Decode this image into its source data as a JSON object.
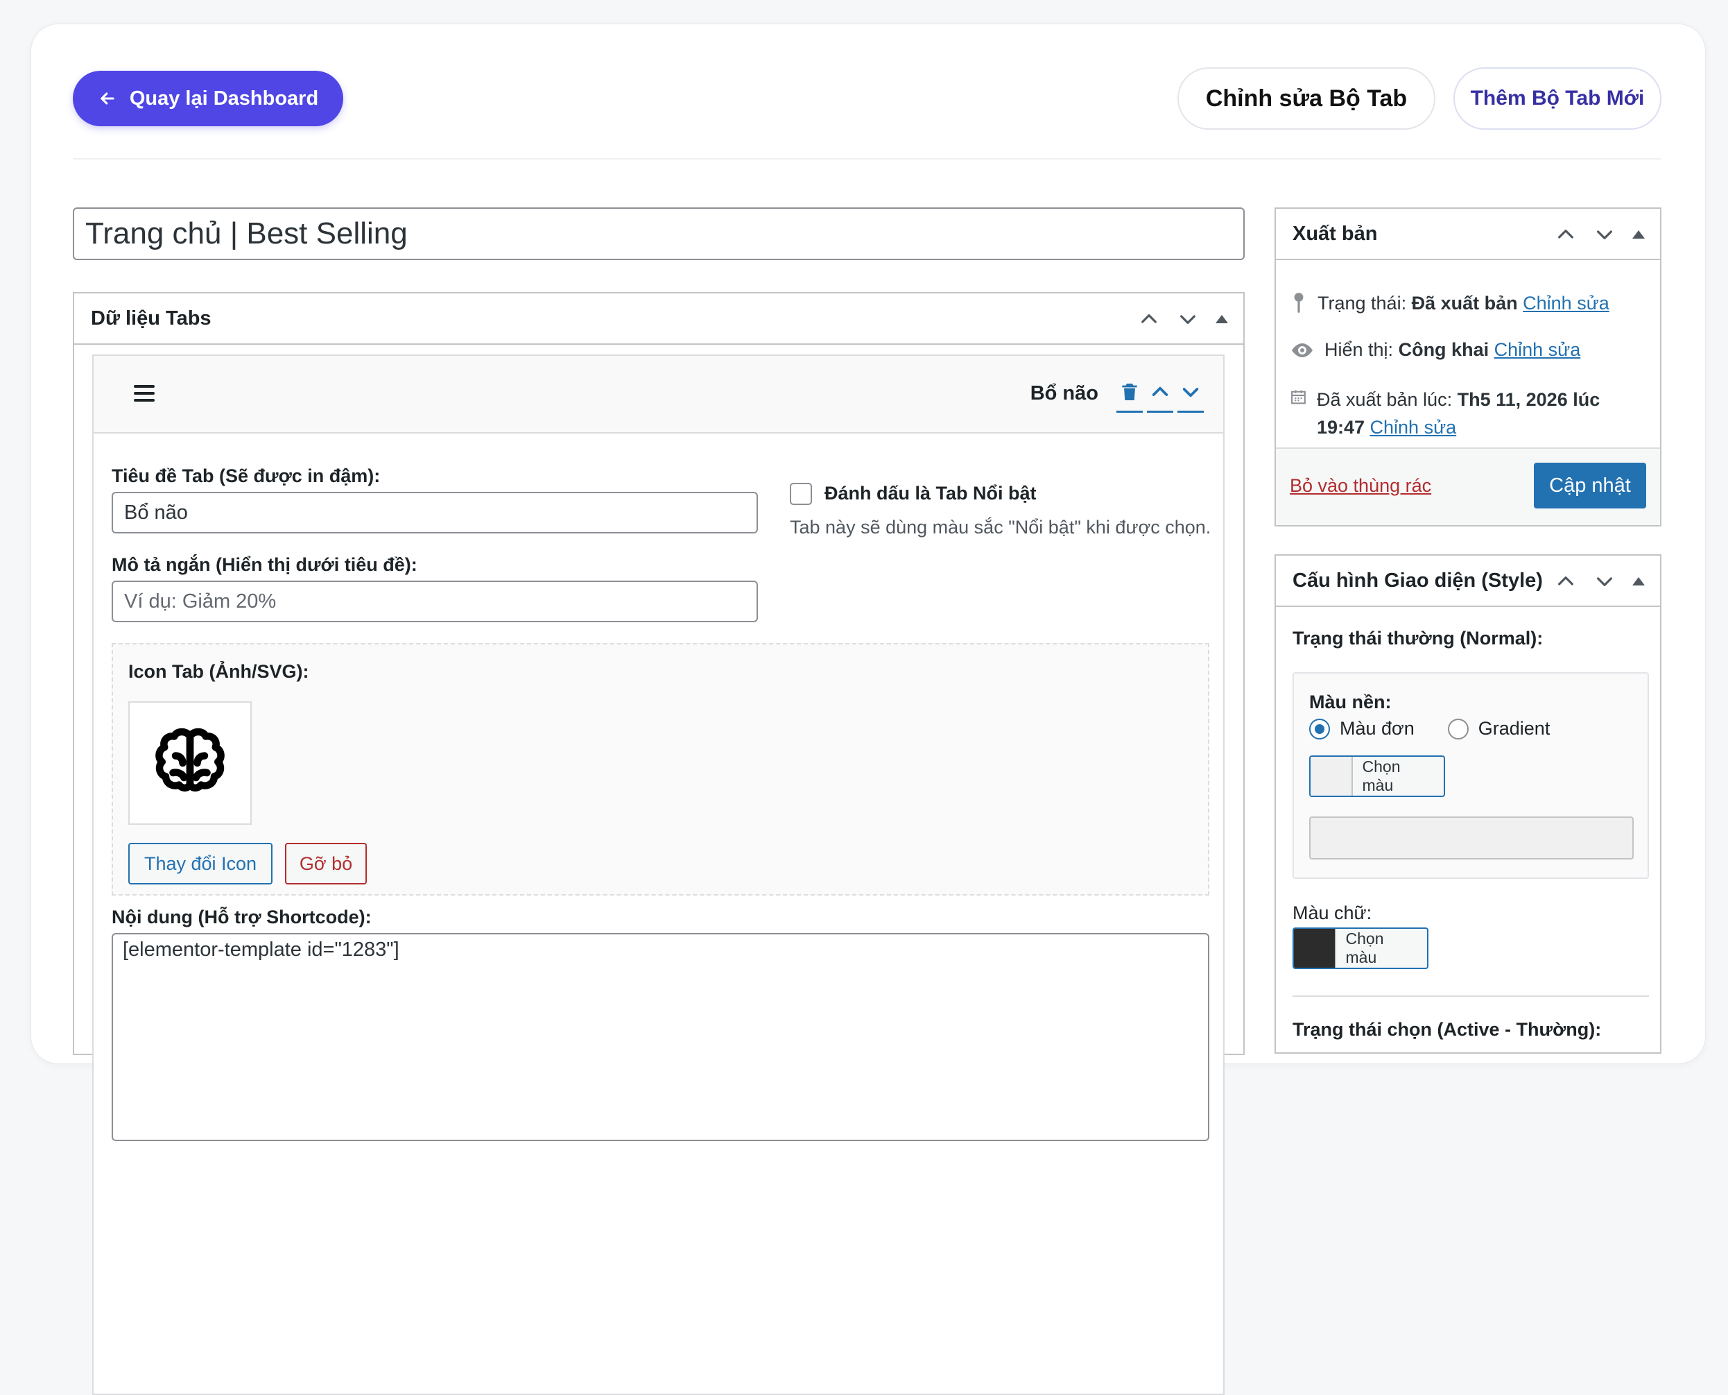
{
  "header": {
    "back_label": "Quay lại Dashboard",
    "edit_label": "Chỉnh sửa Bộ Tab",
    "add_label": "Thêm Bộ Tab Mới"
  },
  "post_title": "Trang chủ | Best Selling",
  "tabs_box": {
    "title": "Dữ liệu Tabs",
    "item": {
      "name": "Bổ não",
      "title_label": "Tiêu đề Tab (Sẽ được in đậm):",
      "title_value": "Bổ não",
      "desc_label": "Mô tả ngắn (Hiển thị dưới tiêu đề):",
      "desc_placeholder": "Ví dụ: Giảm 20%",
      "featured_label": "Đánh dấu là Tab Nổi bật",
      "featured_help": "Tab này sẽ dùng màu sắc \"Nổi bật\" khi được chọn.",
      "featured_checked": false,
      "icon_label": "Icon Tab (Ảnh/SVG):",
      "icon_name": "brain-icon",
      "change_icon_label": "Thay đổi Icon",
      "remove_icon_label": "Gỡ bỏ",
      "content_label": "Nội dung (Hỗ trợ Shortcode):",
      "content_value": "[elementor-template id=\"1283\"]"
    }
  },
  "publish_box": {
    "title": "Xuất bản",
    "status_label": "Trạng thái:",
    "status_value": "Đã xuất bản",
    "visibility_label": "Hiển thị:",
    "visibility_value": "Công khai",
    "published_label": "Đã xuất bản lúc:",
    "published_value": "Th5 11, 2026 lúc 19:47",
    "edit_link": "Chỉnh sửa",
    "trash_label": "Bỏ vào thùng rác",
    "update_label": "Cập nhật"
  },
  "style_box": {
    "title": "Cấu hình Giao diện (Style)",
    "normal_label": "Trạng thái thường (Normal):",
    "bg_label": "Màu nền:",
    "bg_option_solid": "Màu đơn",
    "bg_option_gradient": "Gradient",
    "bg_selected": "Màu đơn",
    "pick_color_label": "Chọn màu",
    "bg_swatch": "#f0f0f1",
    "text_color_label": "Màu chữ:",
    "text_swatch": "#2c2c2c",
    "active_label": "Trạng thái chọn (Active - Thường):"
  },
  "colors": {
    "primary": "#4f46e5",
    "wp_blue": "#2271b1",
    "danger": "#b32d2e"
  }
}
